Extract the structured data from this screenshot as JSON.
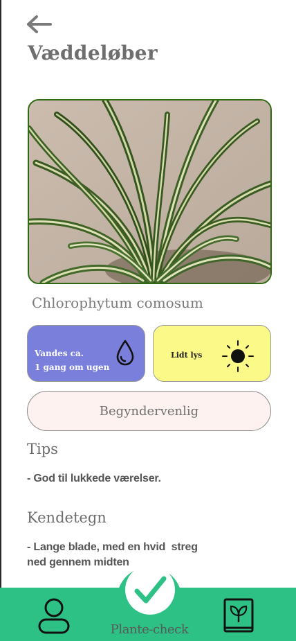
{
  "header": {
    "back_icon": "arrow-left-icon",
    "title": "Væddeløber"
  },
  "plant": {
    "latin_name": "Chlorophytum comosum",
    "photo_description_icon": "plant-photo"
  },
  "care": {
    "water": {
      "line1": "Vandes ca.",
      "line2": "1 gang om ugen",
      "icon": "water-drop-icon",
      "color": "#7b7fdc"
    },
    "light": {
      "label": "Lidt lys",
      "icon": "sun-icon",
      "color": "#fbf987"
    },
    "difficulty": "Begyndervenlig"
  },
  "tips": {
    "heading": "Tips",
    "body": "- God til lukkede værelser."
  },
  "features": {
    "heading": "Kendetegn",
    "body_line1": "- Lange blade, med en hvid  streg",
    "body_line2": "ned gennem midten"
  },
  "nav": {
    "profile_icon": "user-icon",
    "check_icon": "checkmark-icon",
    "check_label": "Plante-check",
    "book_icon": "plant-book-icon",
    "color": "#2ec185"
  }
}
